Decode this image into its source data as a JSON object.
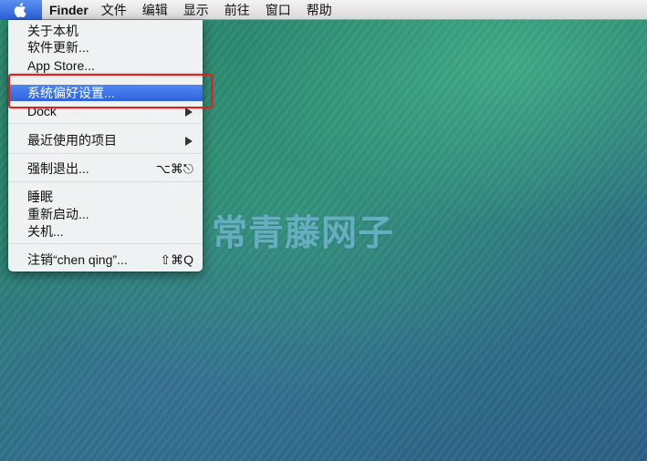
{
  "menubar": {
    "apple_icon": "apple-logo",
    "app_name": "Finder",
    "menus": [
      "文件",
      "编辑",
      "显示",
      "前往",
      "窗口",
      "帮助"
    ]
  },
  "apple_menu": {
    "items": [
      {
        "label": "关于本机"
      },
      {
        "label": "软件更新..."
      },
      {
        "label": "App Store..."
      },
      {
        "label": "系统偏好设置...",
        "highlighted": true
      },
      {
        "label": "Dock",
        "submenu": true
      },
      {
        "label": "最近使用的项目",
        "submenu": true
      },
      {
        "label": "强制退出...",
        "shortcut": "⌥⌘⎋"
      },
      {
        "label": "睡眠"
      },
      {
        "label": "重新启动..."
      },
      {
        "label": "关机..."
      },
      {
        "label": "注销“chen qing”...",
        "shortcut": "⇧⌘Q"
      }
    ]
  },
  "desktop": {
    "watermark": "常青藤网子"
  },
  "colors": {
    "highlight": "#2e63db",
    "annotation": "#e02020"
  }
}
